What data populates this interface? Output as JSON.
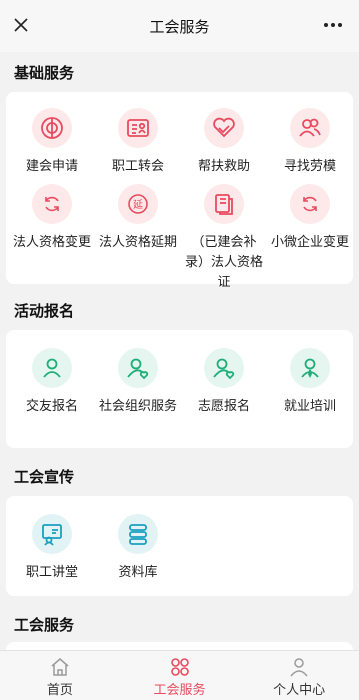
{
  "header": {
    "title": "工会服务",
    "close_icon": "close-icon",
    "more_icon": "more-icon"
  },
  "sections": [
    {
      "title": "基础服务",
      "items": [
        {
          "label": "建会申请",
          "icon": "union-establish-icon",
          "color": "#e84b5f"
        },
        {
          "label": "职工转会",
          "icon": "id-card-icon",
          "color": "#e84b5f"
        },
        {
          "label": "帮扶救助",
          "icon": "heart-hand-icon",
          "color": "#e84b5f"
        },
        {
          "label": "寻找劳模",
          "icon": "user-group-icon",
          "color": "#e84b5f"
        },
        {
          "label": "法人资格变更",
          "icon": "refresh-icon",
          "color": "#e84b5f"
        },
        {
          "label": "法人资格延期",
          "icon": "extend-icon",
          "color": "#e84b5f"
        },
        {
          "label": "（已建会补录）法人资格证",
          "icon": "document-copy-icon",
          "color": "#e84b5f"
        },
        {
          "label": "小微企业变更",
          "icon": "refresh-icon",
          "color": "#e84b5f"
        }
      ]
    },
    {
      "title": "活动报名",
      "items": [
        {
          "label": "交友报名",
          "icon": "user-icon",
          "color": "#1fae7a"
        },
        {
          "label": "社会组织服务",
          "icon": "user-heart-icon",
          "color": "#1fae7a"
        },
        {
          "label": "志愿报名",
          "icon": "user-heart-icon",
          "color": "#1fae7a"
        },
        {
          "label": "就业培训",
          "icon": "user-tie-icon",
          "color": "#1fae7a"
        }
      ]
    },
    {
      "title": "工会宣传",
      "items": [
        {
          "label": "职工讲堂",
          "icon": "lecture-icon",
          "color": "#1a9fbf"
        },
        {
          "label": "资料库",
          "icon": "database-icon",
          "color": "#1a9fbf"
        }
      ]
    },
    {
      "title": "工会服务",
      "items": []
    }
  ],
  "tabbar": {
    "active_color": "#e84b5f",
    "tabs": [
      {
        "label": "首页",
        "icon": "home-icon"
      },
      {
        "label": "工会服务",
        "icon": "grid-icon",
        "active": true
      },
      {
        "label": "个人中心",
        "icon": "person-icon"
      }
    ]
  }
}
